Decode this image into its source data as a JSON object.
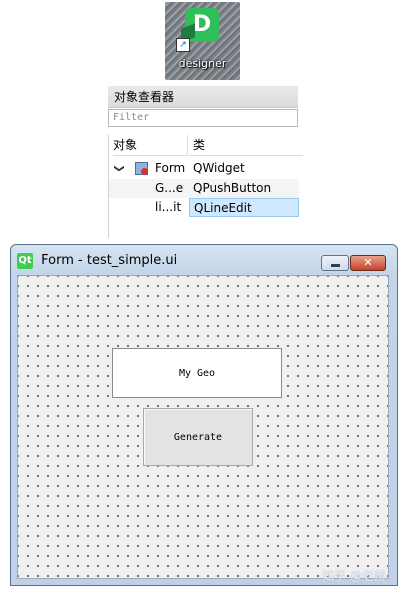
{
  "desktop_icon": {
    "label": "designer",
    "logo_letter": "D",
    "icon_name": "qt-designer-icon"
  },
  "object_inspector": {
    "title": "对象查看器",
    "filter_placeholder": "Filter",
    "columns": [
      "对象",
      "类"
    ],
    "rows": [
      {
        "object": "Form",
        "class": "QWidget",
        "expanded": true
      },
      {
        "object": "G...e",
        "class": "QPushButton"
      },
      {
        "object": "li...it",
        "class": "QLineEdit",
        "selected": true
      }
    ],
    "expand_glyph": "❯"
  },
  "form_window": {
    "logo": "Qt",
    "title": "Form - test_simple.ui",
    "close_glyph": "✕",
    "line_edit_text": "My Geo",
    "push_button_text": "Generate"
  },
  "watermark": "知乎 @老赫"
}
